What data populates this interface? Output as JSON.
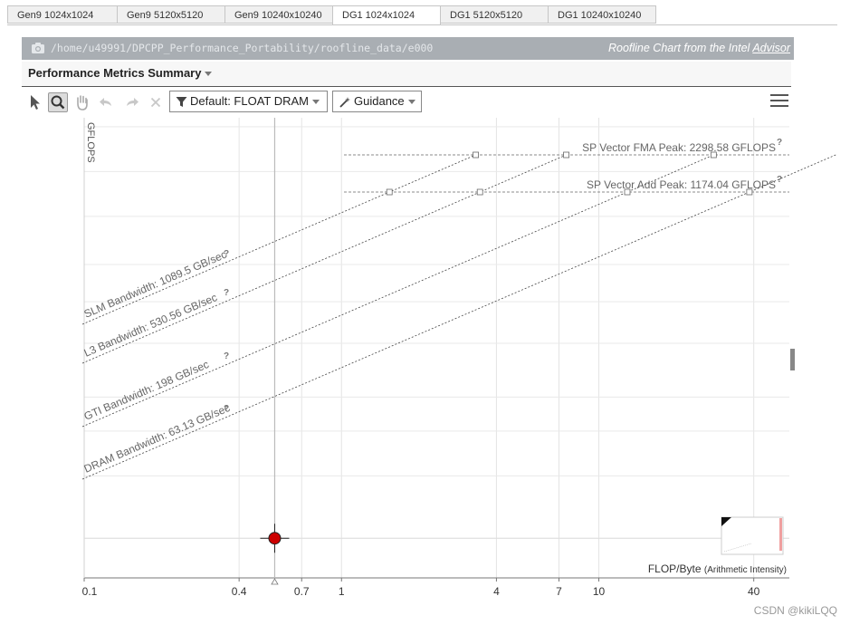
{
  "tabs": [
    {
      "label": "Gen9 1024x1024",
      "active": false
    },
    {
      "label": "Gen9 5120x5120",
      "active": false
    },
    {
      "label": "Gen9 10240x10240",
      "active": false
    },
    {
      "label": "DG1 1024x1024",
      "active": true
    },
    {
      "label": "DG1 5120x5120",
      "active": false
    },
    {
      "label": "DG1 10240x10240",
      "active": false
    }
  ],
  "path": "/home/u49991/DPCPP_Performance_Portability/roofline_data/e000",
  "brand": {
    "prefix": "Roofline Chart from the Intel ",
    "link": "Advisor"
  },
  "summary_title": "Performance Metrics Summary",
  "toolbar": {
    "filter_label": "Default: FLOAT DRAM",
    "guidance_label": "Guidance"
  },
  "watermark": "CSDN @kikiLQQ",
  "chart_data": {
    "type": "scatter",
    "title": "",
    "ylabel": "GFLOPS",
    "xlabel": "FLOP/Byte",
    "xlabel_suffix": "(Arithmetic Intensity)",
    "xscale": "log",
    "yscale": "log",
    "xlim": [
      0.1,
      55
    ],
    "x_ticks": [
      0.1,
      0.4,
      0.7,
      1,
      4,
      7,
      10,
      40
    ],
    "x_tick_labels": [
      "0.1",
      "0.4",
      "0.7",
      "1",
      "4",
      "7",
      "10",
      "40"
    ],
    "compute_roofs": [
      {
        "label": "SP Vector FMA Peak: 2298.58 GFLOPS",
        "gflops": 2298.58,
        "help": "?"
      },
      {
        "label": "SP Vector Add Peak: 1174.04 GFLOPS",
        "gflops": 1174.04,
        "help": "?"
      }
    ],
    "memory_roofs": [
      {
        "label": "SLM Bandwidth: 1089.5 GB/sec",
        "gbps": 1089.5,
        "help": "?"
      },
      {
        "label": "L3 Bandwidth: 530.56 GB/sec",
        "gbps": 530.56,
        "help": "?"
      },
      {
        "label": "GTI Bandwidth: 198 GB/sec",
        "gbps": 198,
        "help": "?"
      },
      {
        "label": "DRAM Bandwidth: 63.13 GB/sec",
        "gbps": 63.13,
        "help": "?"
      }
    ],
    "points": [
      {
        "x": 0.55,
        "y": 0.56,
        "color": "#cc0000"
      }
    ],
    "grid": true
  }
}
